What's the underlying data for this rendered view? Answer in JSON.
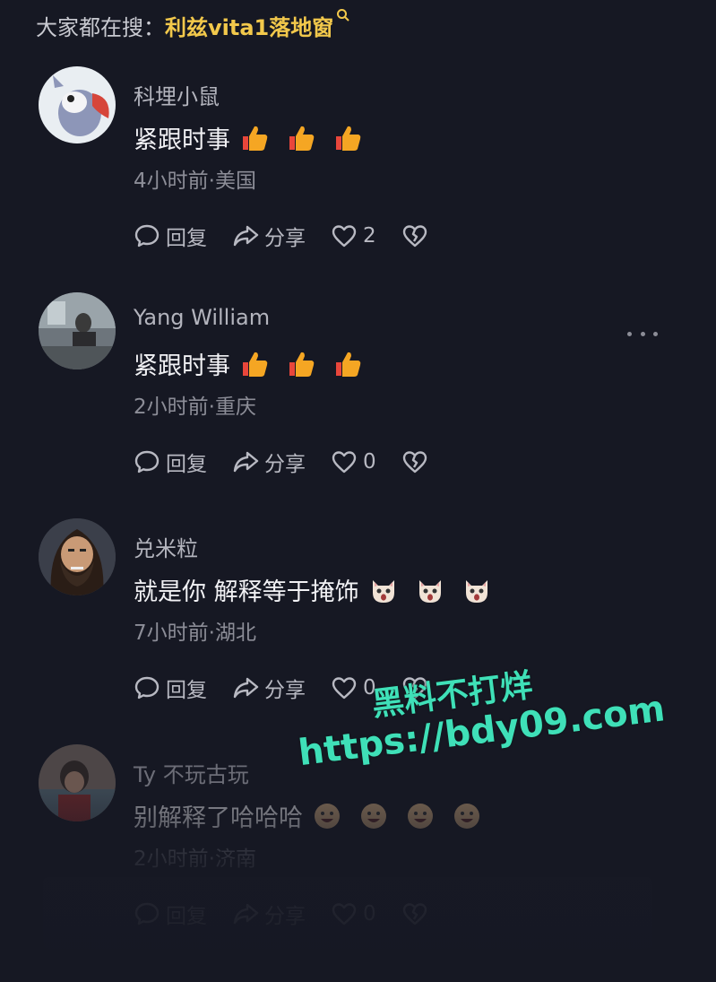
{
  "search_hint": {
    "label": "大家都在搜：",
    "term": "利兹vita1落地窗"
  },
  "comments": [
    {
      "username": "科埋小鼠",
      "text": "紧跟时事",
      "emoji": "thumbs-up",
      "emoji_count": 3,
      "meta": "4小时前·美国",
      "reply_label": "回复",
      "share_label": "分享",
      "like_count": "2"
    },
    {
      "username": "Yang William",
      "text": "紧跟时事",
      "emoji": "thumbs-up",
      "emoji_count": 3,
      "meta": "2小时前·重庆",
      "reply_label": "回复",
      "share_label": "分享",
      "like_count": "0"
    },
    {
      "username": "兑米粒",
      "text": "就是你 解释等于掩饰",
      "emoji": "shocked-cat",
      "emoji_count": 3,
      "meta": "7小时前·湖北",
      "reply_label": "回复",
      "share_label": "分享",
      "like_count": "0"
    },
    {
      "username": "Ty 不玩古玩",
      "text": "别解释了哈哈哈",
      "emoji": "grin-face",
      "emoji_count": 4,
      "meta": "2小时前·济南",
      "reply_label": "回复",
      "share_label": "分享",
      "like_count": "0"
    }
  ],
  "watermark": {
    "line1": "黑料不打烊",
    "line2": "https://bdy09.com"
  },
  "colors": {
    "background": "#161823",
    "search_term": "#f2c84b",
    "watermark": "#3fe0b8",
    "thumb": "#f5a623"
  }
}
